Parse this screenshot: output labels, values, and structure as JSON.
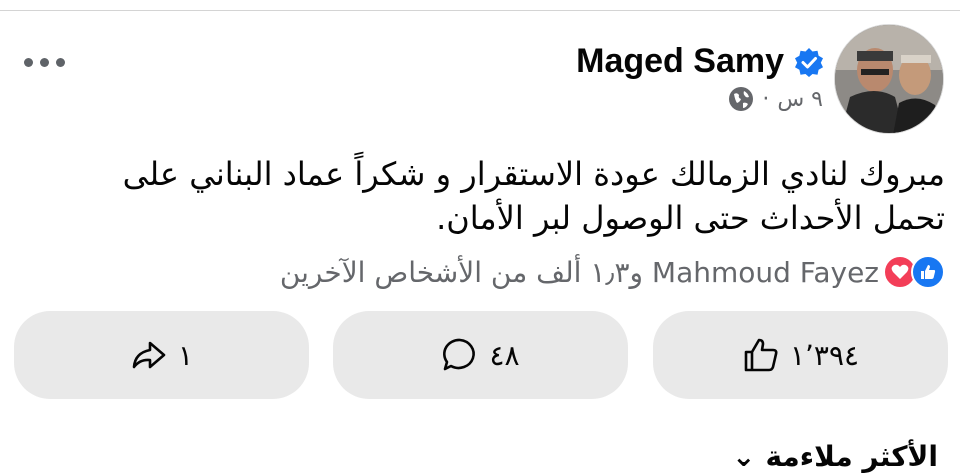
{
  "post": {
    "author": "Maged Samy",
    "time": "٩ س",
    "separator": "·",
    "text": "مبروك لنادي الزمالك عودة الاستقرار و شكراً عماد البناني على تحمل الأحداث حتى الوصول لبر الأمان.",
    "reactions_summary": "Mahmoud Fayez و١٫٣ ألف من الأشخاص الآخرين",
    "icons": {
      "verified": "verified-badge-icon",
      "privacy": "globe-icon",
      "more": "more-horizontal-icon",
      "like": "like-reaction-icon",
      "love": "love-reaction-icon"
    }
  },
  "actions": {
    "like_count": "١٬٣٩٤",
    "comment_count": "٤٨",
    "share_count": "١"
  },
  "comments": {
    "sort_label": "الأكثر ملاءمة"
  },
  "colors": {
    "accent": "#1877f2",
    "love": "#f33e58",
    "secondary_text": "#65676b",
    "button_bg": "#e9e9e9"
  }
}
